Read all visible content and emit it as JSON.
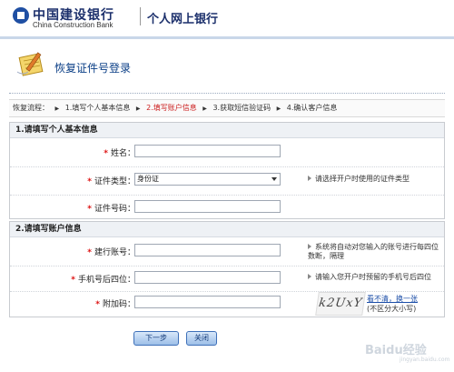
{
  "header": {
    "bank_name_cn": "中国建设银行",
    "bank_name_en": "China Construction Bank",
    "service_title": "个人网上银行"
  },
  "page": {
    "title": "恢复证件号登录"
  },
  "steps": {
    "prefix": "恢复流程：",
    "items": [
      "1.填写个人基本信息",
      "2.填写账户信息",
      "3.获取短信验证码",
      "4.确认客户信息"
    ],
    "current_index": 1
  },
  "section1": {
    "heading": "1.请填写个人基本信息",
    "fields": {
      "name_label": "姓名：",
      "name_value": "",
      "id_type_label": "证件类型：",
      "id_type_value": "身份证",
      "id_type_hint": "请选择开户时使用的证件类型",
      "id_number_label": "证件号码：",
      "id_number_value": ""
    }
  },
  "section2": {
    "heading": "2.请填写账户信息",
    "fields": {
      "account_label": "建行账号：",
      "account_value": "",
      "account_hint": "系统将自动对您输入的账号进行每四位数断，隔理",
      "phone_label": "手机号后四位：",
      "phone_value": "",
      "phone_hint": "请输入您开户时预留的手机号后四位",
      "extra_code_label": "附加码：",
      "extra_code_value": "",
      "captcha_text": "k2UxY",
      "captcha_refresh": "看不清，换一张",
      "captcha_note": "(不区分大小写)"
    }
  },
  "buttons": {
    "next": "下一步",
    "close": "关闭"
  },
  "watermark": {
    "text": "Baidu经验",
    "sub": "jingyan.baidu.com"
  },
  "colors": {
    "brand_blue": "#1b2f6b",
    "title_blue": "#0a3e86",
    "required_star": "#d11111",
    "current_step": "#cc1f1f"
  }
}
